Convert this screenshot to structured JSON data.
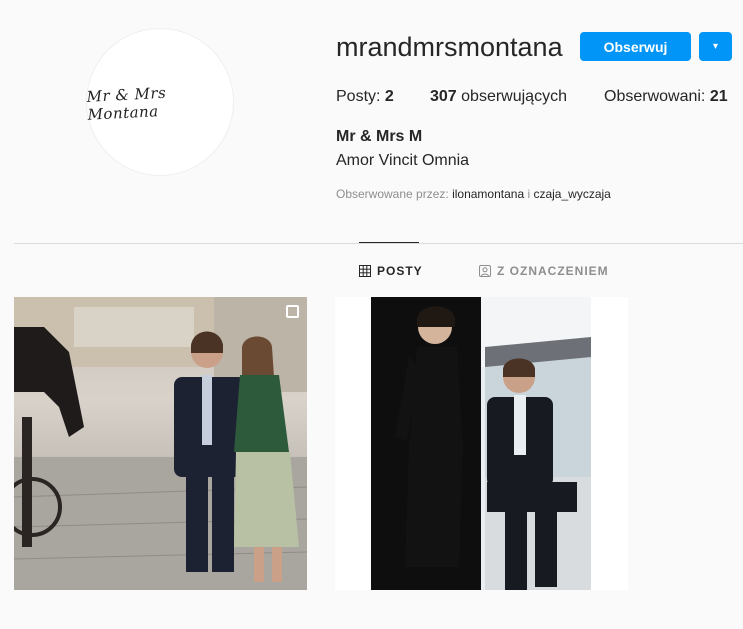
{
  "profile": {
    "avatar_text": "Mr & Mrs Montana",
    "username": "mrandmrsmontana",
    "follow_label": "Obserwuj",
    "dropdown_label": "▾",
    "stats": [
      {
        "label": "Posty: ",
        "value": "2"
      },
      {
        "label": " obserwujących",
        "value": "307"
      },
      {
        "label": "Obserwowani: ",
        "value": "21"
      }
    ],
    "full_name": "Mr & Mrs M",
    "bio": "Amor Vincit Omnia",
    "followed_by_prefix": "Obserwowane przez: ",
    "followed_by_user1": "ilonamontana",
    "followed_by_sep": " i ",
    "followed_by_user2": "czaja_wyczaja"
  },
  "tabs": [
    {
      "label": "POSTY",
      "icon": "grid-icon",
      "active": true
    },
    {
      "label": "Z OZNACZENIEM",
      "icon": "tagged-icon",
      "active": false
    }
  ],
  "posts": [
    {
      "icon": "multiple-photos-icon"
    },
    {
      "icon": "multiple-photos-icon"
    }
  ],
  "colors": {
    "accent": "#0095f6",
    "background": "#fafafa",
    "muted": "#8e8e8e"
  }
}
